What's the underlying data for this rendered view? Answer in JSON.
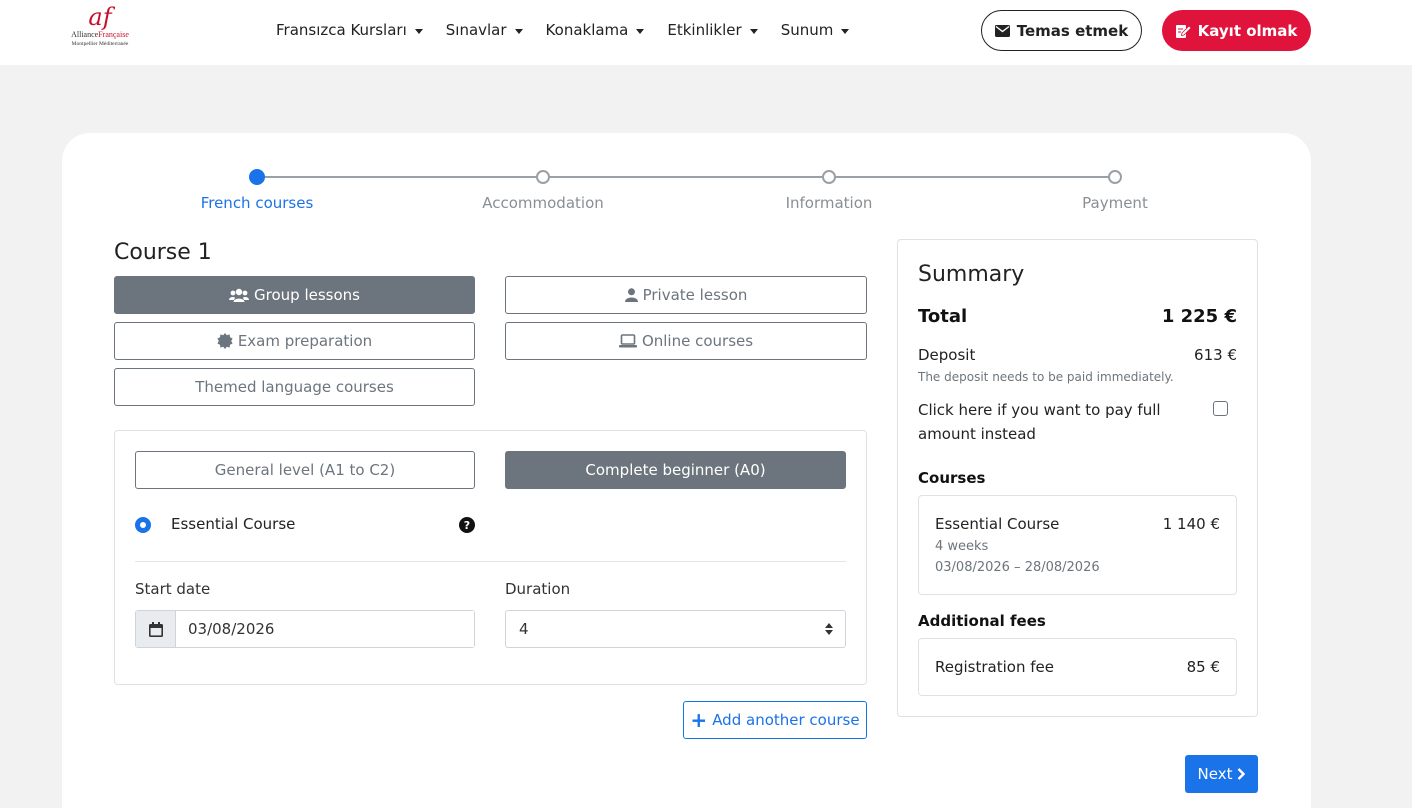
{
  "brand": {
    "logo_mark": "af",
    "logo_name_1": "Alliance",
    "logo_name_2": "Française",
    "logo_sub": "Montpellier Méditerranée",
    "accent": "#e0133d",
    "primary": "#1a73e8"
  },
  "nav": {
    "items": [
      "Fransızca Kursları",
      "Sınavlar",
      "Konaklama",
      "Etkinlikler",
      "Sunum"
    ],
    "contact_label": "Temas etmek",
    "register_label": "Kayıt olmak"
  },
  "stepper": {
    "steps": [
      "French courses",
      "Accommodation",
      "Information",
      "Payment"
    ],
    "active_index": 0
  },
  "course": {
    "title": "Course 1",
    "types": [
      "Group lessons",
      "Private lesson",
      "Exam preparation",
      "Online courses",
      "Themed language courses"
    ],
    "selected_type": "Group lessons",
    "levels": [
      "General level (A1 to C2)",
      "Complete beginner (A0)"
    ],
    "selected_level": "Complete beginner (A0)",
    "option_label": "Essential Course",
    "start_date_label": "Start date",
    "start_date_value": "03/08/2026",
    "duration_label": "Duration",
    "duration_value": "4",
    "add_course_label": "Add another course"
  },
  "summary": {
    "title": "Summary",
    "total_label": "Total",
    "total_value": "1 225 €",
    "deposit_label": "Deposit",
    "deposit_value": "613 €",
    "deposit_note": "The deposit needs to be paid immediately.",
    "pay_full_label": "Click here if you want to pay full amount instead",
    "pay_full_checked": false,
    "courses_heading": "Courses",
    "course_item": {
      "name": "Essential Course",
      "price": "1 140 €",
      "duration": "4 weeks",
      "dates": "03/08/2026 – 28/08/2026"
    },
    "fees_heading": "Additional fees",
    "fee_item": {
      "name": "Registration fee",
      "price": "85 €"
    }
  },
  "next_label": "Next",
  "icons": [
    "envelope-icon",
    "edit-icon",
    "users-icon",
    "user-icon",
    "badge-icon",
    "laptop-icon",
    "question-icon",
    "calendar-icon",
    "plus-icon",
    "chevron-right-icon"
  ]
}
